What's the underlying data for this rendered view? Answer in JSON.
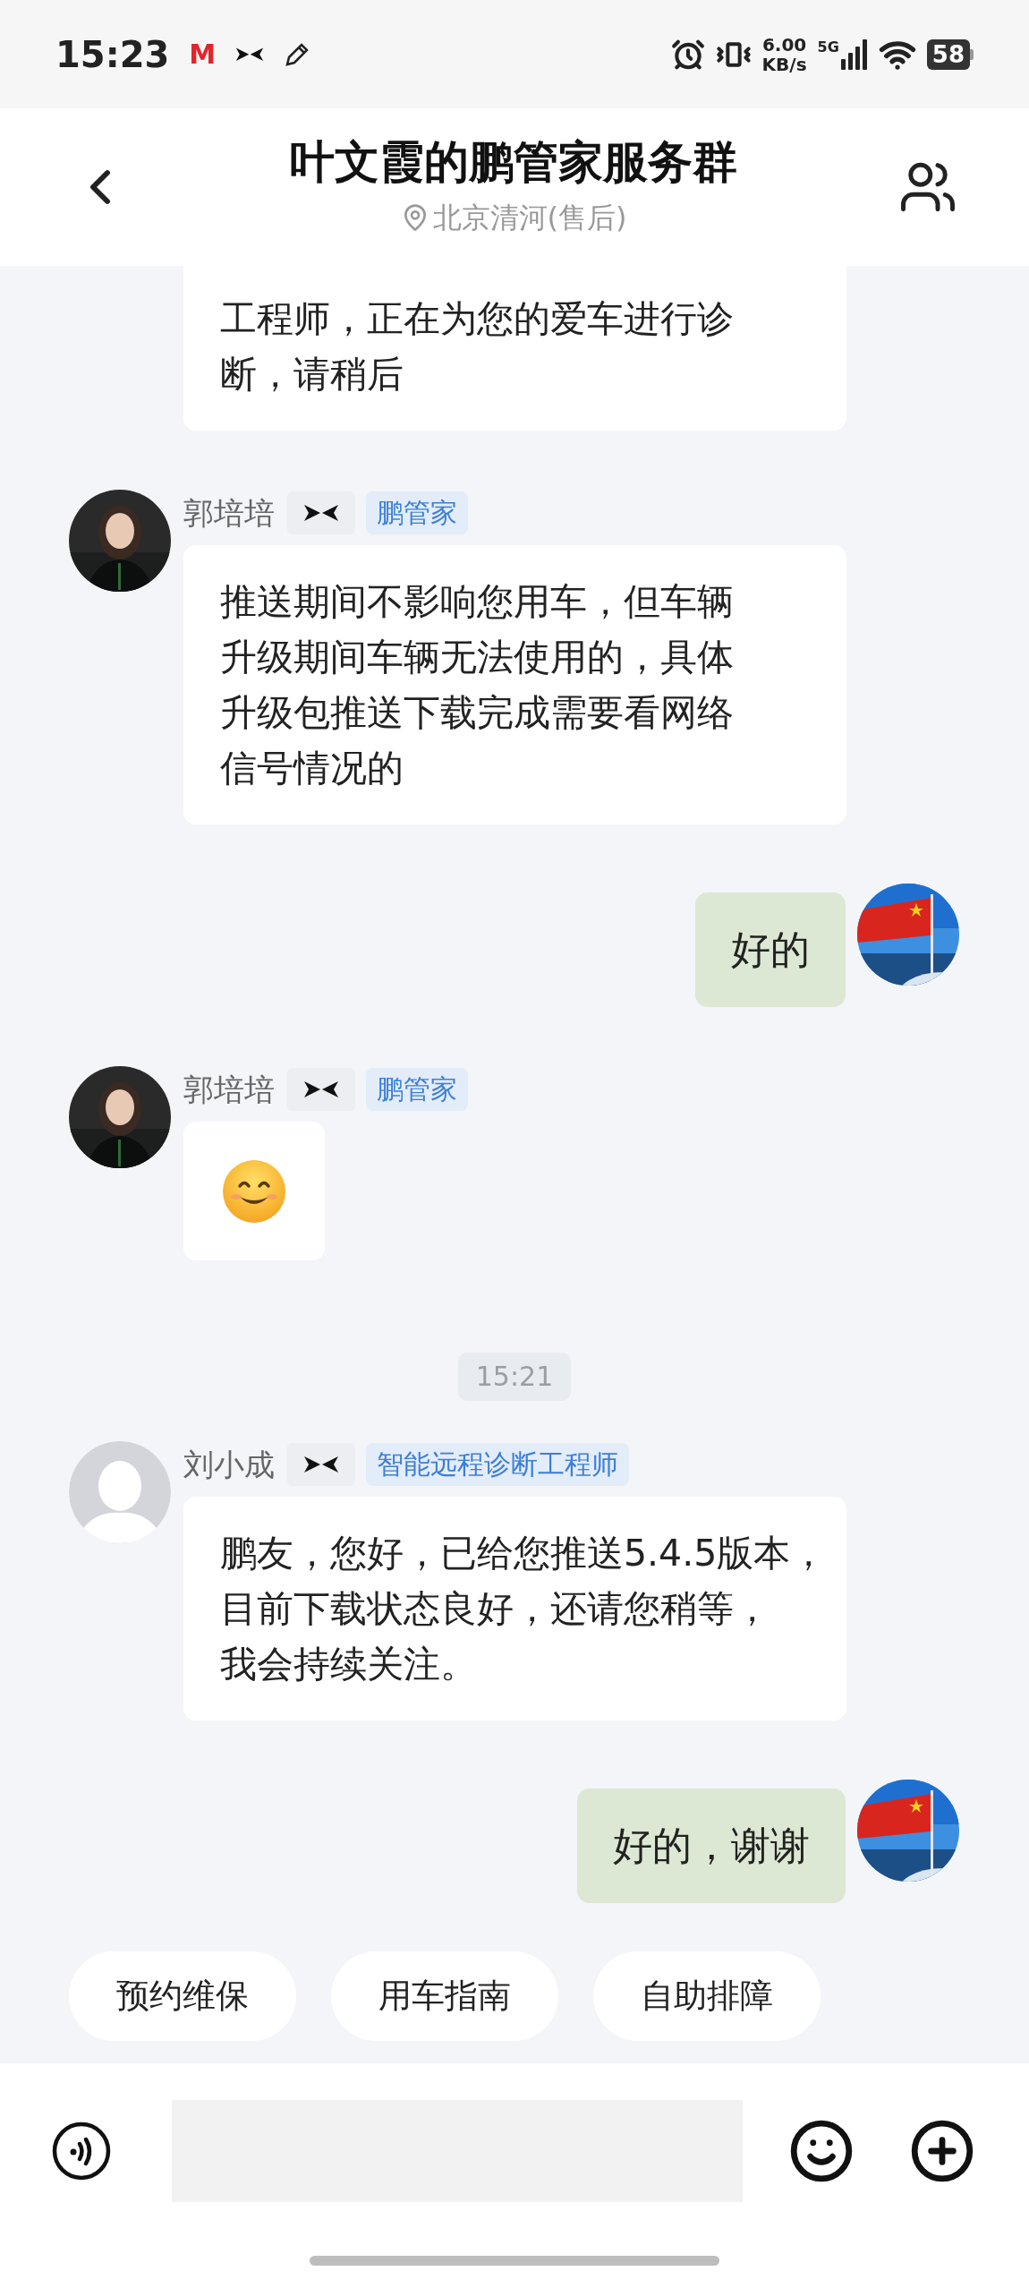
{
  "status_bar": {
    "time": "15:23",
    "app_badge": "M",
    "speed_value": "6.00",
    "speed_unit": "KB/s",
    "network": "5G",
    "battery": "58"
  },
  "header": {
    "title": "叶文霞的鹏管家服务群",
    "location": "北京清河(售后)"
  },
  "messages": [
    {
      "kind": "incoming_text",
      "lines": [
        "工程师，正在为您的爱车进行诊",
        "断，请稍后"
      ]
    },
    {
      "kind": "incoming_text",
      "sender": "郭培培",
      "role": "鹏管家",
      "lines": [
        "推送期间不影响您用车，但车辆",
        "升级期间车辆无法使用的，具体",
        "升级包推送下载完成需要看网络",
        "信号情况的"
      ]
    },
    {
      "kind": "outgoing_text",
      "lines": [
        "好的"
      ]
    },
    {
      "kind": "incoming_emoji",
      "sender": "郭培培",
      "role": "鹏管家"
    },
    {
      "kind": "timestamp",
      "text": "15:21"
    },
    {
      "kind": "incoming_text",
      "sender": "刘小成",
      "role": "智能远程诊断工程师",
      "avatar": {
        "kind": "default"
      },
      "lines": [
        "鹏友，您好，已给您推送5.4.5版本，",
        "目前下载状态良好，还请您稍等，",
        "我会持续关注。"
      ]
    },
    {
      "kind": "outgoing_text",
      "lines": [
        "好的，谢谢"
      ]
    }
  ],
  "quick_actions": [
    "预约维保",
    "用车指南",
    "自助排障"
  ]
}
